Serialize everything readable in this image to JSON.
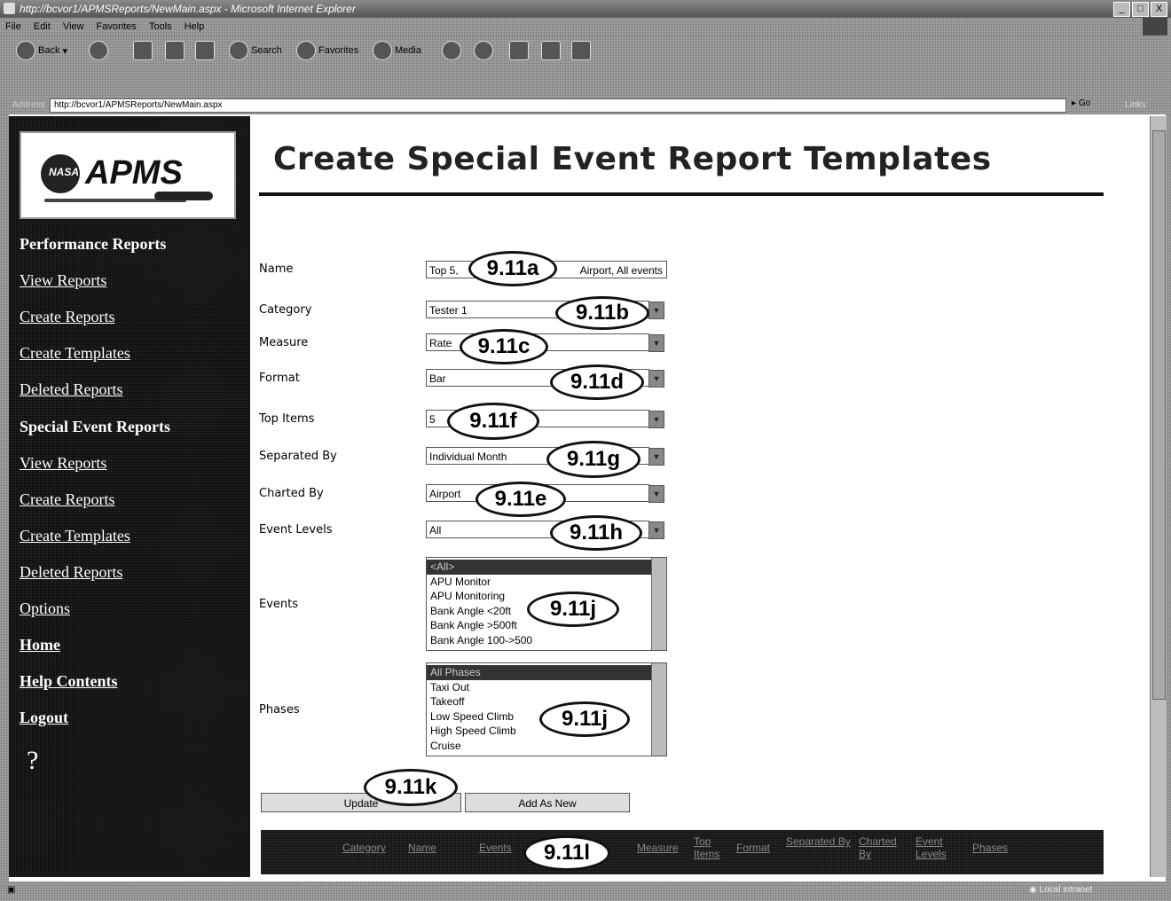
{
  "window": {
    "title": "http://bcvor1/APMSReports/NewMain.aspx - Microsoft Internet Explorer",
    "controls": [
      "_",
      "□",
      "X"
    ]
  },
  "menu": [
    "File",
    "Edit",
    "View",
    "Favorites",
    "Tools",
    "Help"
  ],
  "toolbar": {
    "back": "Back",
    "search": "Search",
    "favorites": "Favorites",
    "media": "Media"
  },
  "address": {
    "label": "Address",
    "url": "http://bcvor1/APMSReports/NewMain.aspx",
    "go": "Go",
    "links": "Links"
  },
  "logo": {
    "badge": "NASA",
    "word": "APMS"
  },
  "sidebar": {
    "sections": [
      {
        "heading": "Performance Reports",
        "links": [
          "View Reports",
          "Create Reports",
          "Create Templates",
          "Deleted Reports"
        ]
      },
      {
        "heading": "Special Event Reports",
        "links": [
          "View Reports",
          "Create Reports",
          "Create Templates",
          "Deleted Reports"
        ]
      }
    ],
    "extra": [
      "Options",
      "Home",
      "Help Contents",
      "Logout"
    ],
    "help_symbol": "?"
  },
  "page": {
    "title": "Create Special Event Report Templates"
  },
  "form": {
    "name": {
      "label": "Name",
      "value_left": "Top 5,",
      "value_right": "Airport, All events"
    },
    "category": {
      "label": "Category",
      "value": "Tester 1"
    },
    "measure": {
      "label": "Measure",
      "value": "Rate"
    },
    "format": {
      "label": "Format",
      "value": "Bar"
    },
    "top_items": {
      "label": "Top Items",
      "value": "5"
    },
    "separated_by": {
      "label": "Separated By",
      "value": "Individual Month"
    },
    "charted_by": {
      "label": "Charted By",
      "value": "Airport"
    },
    "event_levels": {
      "label": "Event Levels",
      "value": "All"
    },
    "events": {
      "label": "Events",
      "options": [
        "<All>",
        "APU Monitor",
        "APU Monitoring",
        "Bank Angle <20ft",
        "Bank Angle >500ft",
        "Bank Angle 100->500"
      ]
    },
    "phases": {
      "label": "Phases",
      "options": [
        "All Phases",
        "Taxi Out",
        "Takeoff",
        "Low Speed Climb",
        "High Speed Climb",
        "Cruise"
      ]
    },
    "update_button": "Update",
    "add_new_button": "Add As New"
  },
  "callouts": {
    "name": "9.11a",
    "category": "9.11b",
    "measure": "9.11c",
    "format": "9.11d",
    "top_items": "9.11f",
    "separated_by": "9.11g",
    "charted_by": "9.11e",
    "event_levels": "9.11h",
    "events": "9.11j",
    "phases": "9.11j",
    "update": "9.11k",
    "footer": "9.11l"
  },
  "footer_columns": [
    "Category",
    "Name",
    "Events",
    "Measure",
    "Top Items",
    "Format",
    "Separated By",
    "Charted By",
    "Event Levels",
    "Phases"
  ],
  "status": {
    "zone": "Local intranet"
  }
}
